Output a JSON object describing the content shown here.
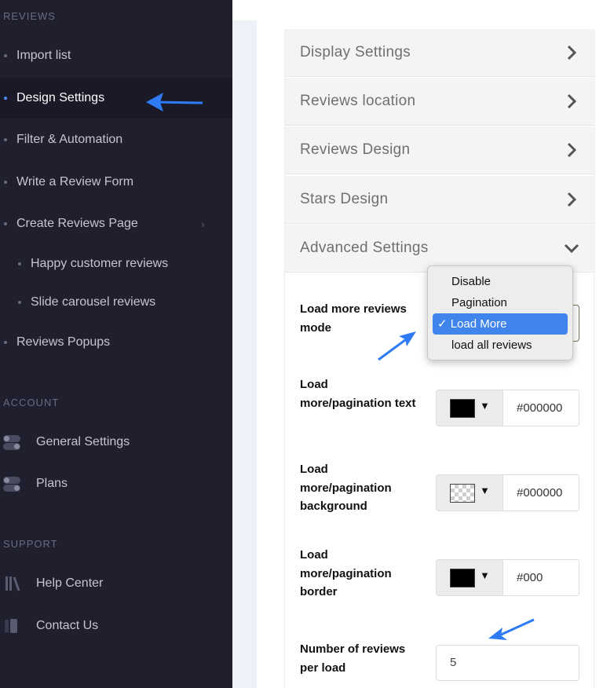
{
  "sidebar": {
    "sections": {
      "reviews": "REVIEWS",
      "account": "ACCOUNT",
      "support": "SUPPORT"
    },
    "reviews_items": [
      {
        "label": "Import list"
      },
      {
        "label": "Design Settings",
        "active": true
      },
      {
        "label": "Filter & Automation"
      },
      {
        "label": "Write a Review Form"
      },
      {
        "label": "Create Reviews Page",
        "chevron": "›"
      },
      {
        "label": "Happy customer reviews"
      },
      {
        "label": "Slide carousel reviews"
      },
      {
        "label": "Reviews Popups"
      }
    ],
    "account_items": [
      {
        "label": "General Settings",
        "icon": "toggle-icon"
      },
      {
        "label": "Plans",
        "icon": "toggle-icon"
      }
    ],
    "support_items": [
      {
        "label": "Help Center",
        "icon": "books-icon"
      },
      {
        "label": "Contact Us",
        "icon": "contact-icon"
      }
    ]
  },
  "accordion": [
    {
      "label": "Display Settings",
      "state": "collapsed"
    },
    {
      "label": "Reviews location",
      "state": "collapsed"
    },
    {
      "label": "Reviews Design",
      "state": "collapsed"
    },
    {
      "label": "Stars Design",
      "state": "collapsed"
    },
    {
      "label": "Advanced Settings",
      "state": "expanded"
    }
  ],
  "advanced": {
    "load_more_mode": {
      "label": "Load more reviews mode",
      "options": [
        "Disable",
        "Pagination",
        "Load More",
        "load all reviews"
      ],
      "selected": "Load More",
      "check": "✓"
    },
    "pagination_text": {
      "label": "Load more/pagination text",
      "value": "#000000"
    },
    "pagination_background": {
      "label": "Load more/pagination background",
      "value": "#000000"
    },
    "pagination_border": {
      "label": "Load more/pagination border",
      "value": "#000"
    },
    "reviews_per_load": {
      "label": "Number of reviews per load",
      "value": "5"
    },
    "caret": "▼"
  },
  "colors": {
    "sidebar_bg": "#1f1f2e",
    "sidebar_active_bg": "#191927",
    "accent": "#4c8dff",
    "annotation_arrow": "#2f7bf5",
    "dropdown_selected": "#3f85ec"
  }
}
